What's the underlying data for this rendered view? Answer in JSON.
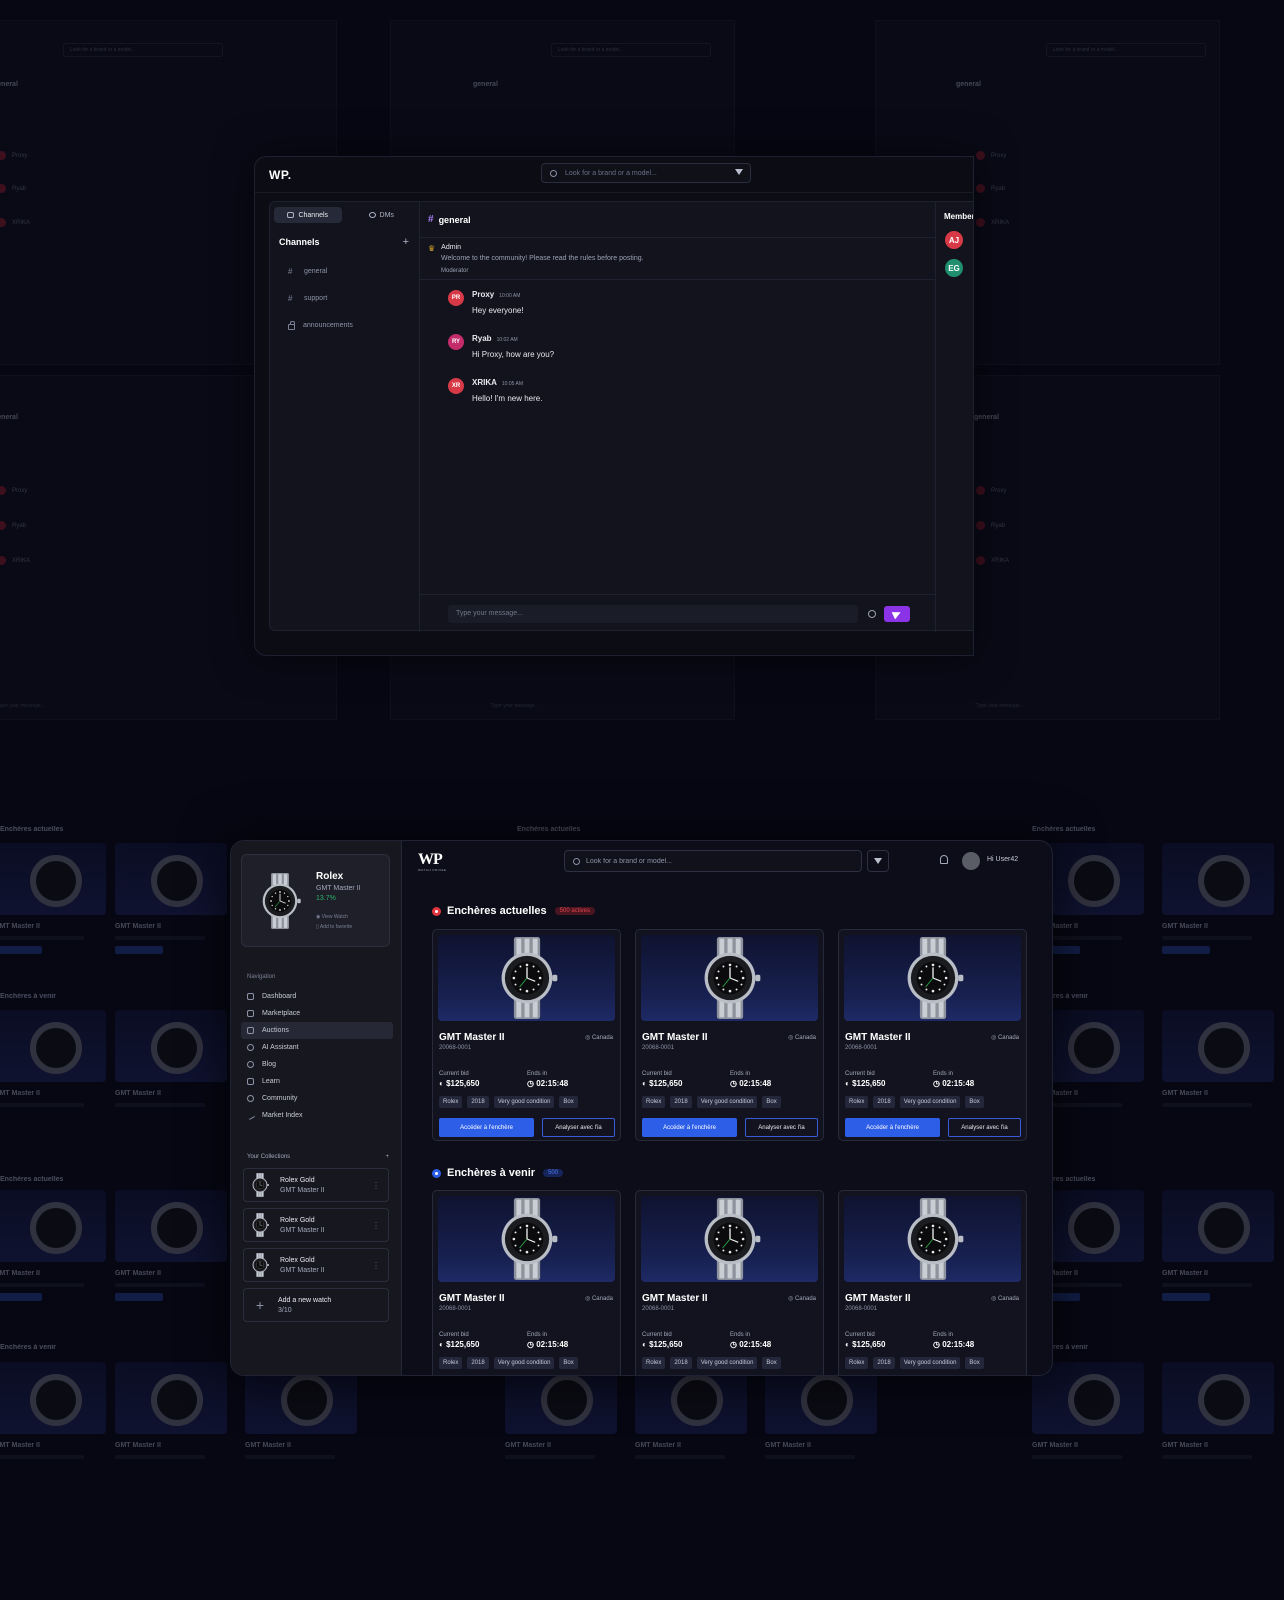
{
  "colors": {
    "page_bg": "#070714",
    "accent_blue": "#2d5ee8",
    "accent_purple": "#8b33e6",
    "live_red": "#e0343d",
    "positive_green": "#28b36b"
  },
  "chat": {
    "logo": "WP.",
    "search_placeholder": "Look for a brand or a model...",
    "tabs": [
      {
        "label": "Channels",
        "icon": "chat-bubble-icon",
        "active": true
      },
      {
        "label": "DMs",
        "icon": "users-icon",
        "active": false
      }
    ],
    "channels_title": "Channels",
    "channels": [
      {
        "name": "general",
        "icon": "hash-icon"
      },
      {
        "name": "support",
        "icon": "hash-icon"
      },
      {
        "name": "announcements",
        "icon": "lock-icon"
      }
    ],
    "current_channel": "general",
    "pinned": {
      "author": "Admin",
      "text": "Welcome to the community! Please read the rules before posting.",
      "next_role": "Moderator"
    },
    "messages": [
      {
        "initials": "PR",
        "name": "Proxy",
        "time": "10:00 AM",
        "text": "Hey everyone!"
      },
      {
        "initials": "RY",
        "name": "Ryab",
        "time": "10:02 AM",
        "text": "Hi Proxy, how are you?"
      },
      {
        "initials": "XR",
        "name": "XRIKA",
        "time": "10:05 AM",
        "text": "Hello! I'm new here."
      }
    ],
    "input_placeholder": "Type your message...",
    "members_title": "Members",
    "members": [
      {
        "initials": "AJ",
        "color": "#d73a46"
      },
      {
        "initials": "EG",
        "color": "#1f8f6f"
      }
    ]
  },
  "market": {
    "logo": "WP",
    "logo_sub": "WATCH PRIVEE",
    "search_placeholder": "Look for a brand or model...",
    "user_greeting": "Hi User42",
    "featured": {
      "brand": "Rolex",
      "model": "GMT Master II",
      "change": "13.7%",
      "view_label": "View Watch",
      "fav_label": "Add to favorite"
    },
    "nav_label": "Navigation",
    "nav": [
      {
        "label": "Dashboard",
        "icon": "home-icon",
        "active": false
      },
      {
        "label": "Marketplace",
        "icon": "store-icon",
        "active": false
      },
      {
        "label": "Auctions",
        "icon": "gavel-icon",
        "active": true
      },
      {
        "label": "AI Assistant",
        "icon": "robot-icon",
        "active": false
      },
      {
        "label": "Blog",
        "icon": "broadcast-icon",
        "active": false
      },
      {
        "label": "Learn",
        "icon": "book-icon",
        "active": false
      },
      {
        "label": "Community",
        "icon": "chat-icon",
        "active": false
      },
      {
        "label": "Market Index",
        "icon": "trend-icon",
        "active": false
      }
    ],
    "collections_title": "Your Collections",
    "collections": [
      {
        "name": "Rolex Gold",
        "model": "GMT Master II"
      },
      {
        "name": "Rolex Gold",
        "model": "GMT Master II"
      },
      {
        "name": "Rolex Gold",
        "model": "GMT Master II"
      }
    ],
    "add_watch": {
      "label": "Add a new watch",
      "count": "3/10"
    },
    "sections": [
      {
        "title": "Enchères actuelles",
        "badge": "500 actives",
        "dot_color": "#e0343d",
        "badge_bg": "#4a1520",
        "badge_color": "#e0434c",
        "cards": [
          {
            "title": "GMT Master II",
            "location": "Canada",
            "ref": "20068-0001",
            "bid_label": "Current bid",
            "bid": "$125,650",
            "end_label": "Ends in",
            "end": "02:15:48",
            "tags": [
              "Rolex",
              "2018",
              "Very good condition",
              "Box"
            ],
            "primary": "Accéder à l'enchère",
            "secondary": "Analyser avec l'ia"
          },
          {
            "title": "GMT Master II",
            "location": "Canada",
            "ref": "20068-0001",
            "bid_label": "Current bid",
            "bid": "$125,650",
            "end_label": "Ends in",
            "end": "02:15:48",
            "tags": [
              "Rolex",
              "2018",
              "Very good condition",
              "Box"
            ],
            "primary": "Accéder à l'enchère",
            "secondary": "Analyser avec l'ia"
          },
          {
            "title": "GMT Master II",
            "location": "Canada",
            "ref": "20068-0001",
            "bid_label": "Current bid",
            "bid": "$125,650",
            "end_label": "Ends in",
            "end": "02:15:48",
            "tags": [
              "Rolex",
              "2018",
              "Very good condition",
              "Box"
            ],
            "primary": "Accéder à l'enchère",
            "secondary": "Analyser avec l'ia"
          }
        ]
      },
      {
        "title": "Enchères à venir",
        "badge": "500",
        "dot_color": "#2d5ee8",
        "badge_bg": "#16245a",
        "badge_color": "#4d7df0",
        "cards": [
          {
            "title": "GMT Master II",
            "location": "Canada",
            "ref": "20068-0001",
            "bid_label": "Current bid",
            "bid": "$125,650",
            "end_label": "Ends in",
            "end": "02:15:48",
            "tags": [
              "Rolex",
              "2018",
              "Very good condition",
              "Box"
            ]
          },
          {
            "title": "GMT Master II",
            "location": "Canada",
            "ref": "20068-0001",
            "bid_label": "Current bid",
            "bid": "$125,650",
            "end_label": "Ends in",
            "end": "02:15:48",
            "tags": [
              "Rolex",
              "2018",
              "Very good condition",
              "Box"
            ]
          },
          {
            "title": "GMT Master II",
            "location": "Canada",
            "ref": "20068-0001",
            "bid_label": "Current bid",
            "bid": "$125,650",
            "end_label": "Ends in",
            "end": "02:15:48",
            "tags": [
              "Rolex",
              "2018",
              "Very good condition",
              "Box"
            ]
          }
        ]
      }
    ]
  }
}
